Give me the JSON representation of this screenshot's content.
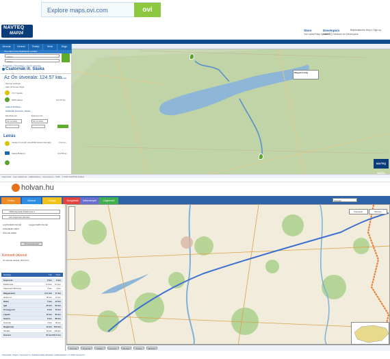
{
  "banner": {
    "ovi_text": "Explore maps.ovi.com",
    "ovi_logo": "ovi"
  },
  "navteq": {
    "logo_top": "NAVTEQ",
    "logo_bottom": "MAP24",
    "header_cols": [
      {
        "title": "Store",
        "text": "Get Latest Map Updates"
      },
      {
        "title": "Developers",
        "text": "NAVTEQ Network for Developers"
      },
      {
        "title": "",
        "text": "Bejelentkezés Helyi  |  Sign up"
      }
    ],
    "tabs": [
      "Útvonal-tervezés",
      "Kereső",
      "Térkép",
      "Hírek",
      "Súgó"
    ],
    "options_bar": "Útvonaltervezés  Beállítások  Letöltés",
    "from_value": "Siófok",
    "to_value": "Sáska",
    "breadcrumb": "Nyitóoldal » Útvonalterv » Az Ön útvonala",
    "title": "Csatornák ill. Sáska",
    "route_label": "Az Ön útvonala: 124.57 km",
    "print_label": "Nyomtat",
    "route_info": [
      "› Útvonal részletei",
      "› Start 30 Route Flight"
    ],
    "stops": [
      {
        "name": "7177 Siófok",
        "dist": ""
      },
      {
        "name": "8308 Sáska",
        "dist": "124.57 km"
      }
    ],
    "links": [
      "Adatok feltöltése",
      "Szállodák keresése: Sáska"
    ],
    "date_labels": [
      "Elindítási ido",
      "Érkezési ido"
    ],
    "dates": [
      "24.12.2010",
      "25.12.2010"
    ],
    "leiras": "Leírás",
    "steps": [
      {
        "text": "Induljon Kossuth utca 8500 Siófok irányába",
        "dist": "0.02 km"
      },
      {
        "text": "Sáska Balatoni",
        "dist": "124.55 km"
      }
    ],
    "popup": "Magyarország",
    "map_logo": "NAVTEQ MAP24",
    "footer": "Kapcsolat · Jogi nyilatkozat · Adatvédelem · Impresszum · Sütik · © 2010 NAVTEQ Global"
  },
  "holvan": {
    "logo": "holvan.hu",
    "tabs": [
      "Térkép",
      "Útvonal",
      "Címlap",
      "Szolgáltató",
      "Intézmények",
      "Cégkereső"
    ],
    "top_search": "Keresés",
    "from_value": "7000 Kaposvár Petőfi utca 2",
    "to_value": "Cél: Kaposvár-Szentes",
    "options": [
      "Legrövidebb útvonal",
      "Leggyorsabb útvonal",
      "Autópályák nélkül",
      "Kompok nélkül"
    ],
    "button": "Útvonal keresés",
    "found_label": "Keresett útvonal",
    "summary": "Az útvonal hossza: 201,5 km",
    "columns": [
      "Helység",
      "Táv",
      "Össz."
    ],
    "rows": [
      {
        "name": "Kaposvár",
        "d": "0 km",
        "t": "0 km",
        "city": true
      },
      {
        "name": "Petőfi utca",
        "d": "0.3 km",
        "t": "0.3 km",
        "city": false
      },
      {
        "name": "Kaposvár Pázmány",
        "d": "3 km",
        "t": "3 km",
        "city": false
      },
      {
        "name": "Magyaratád",
        "d": "14.5 km",
        "t": "17 km",
        "city": true
      },
      {
        "name": "Hetesi út",
        "d": "20 km",
        "t": "37 km",
        "city": false
      },
      {
        "name": "Ráksi",
        "d": "5 km",
        "t": "42 km",
        "city": true
      },
      {
        "name": "Igal",
        "d": "20 km",
        "t": "62 km",
        "city": true
      },
      {
        "name": "Somogyszil",
        "d": "8 km",
        "t": "70 km",
        "city": true
      },
      {
        "name": "Lápafő",
        "d": "10 km",
        "t": "80 km",
        "city": true
      },
      {
        "name": "Szakcs",
        "d": "9 km",
        "t": "89 km",
        "city": true
      },
      {
        "name": "Kocsola",
        "d": "4 km",
        "t": "93 km",
        "city": false
      },
      {
        "name": "Nagykónyi",
        "d": "12 km",
        "t": "105 km",
        "city": true
      },
      {
        "name": "Tamási",
        "d": "15 km",
        "t": "120 km",
        "city": false
      },
      {
        "name": "Szentes",
        "d": "81 km",
        "t": "201.5 km",
        "city": true
      }
    ],
    "map_buttons": [
      "Kaposvár",
      "Szentes"
    ],
    "map_tools": [
      "Útvonal",
      "Nyomtat",
      "Küldés",
      "Keresés",
      "Mentés",
      "Térkép",
      "Műhold"
    ],
    "footer": "Kapcsolat | Súgó | Impresszum | Felhasználási feltételek | Adatvédelem | © 2010 holvan.hu"
  }
}
